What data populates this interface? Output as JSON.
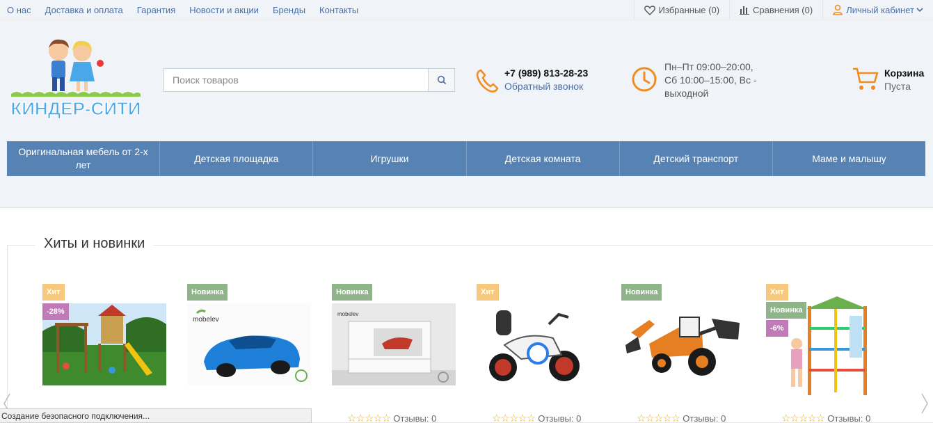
{
  "topnav": [
    "О нас",
    "Доставка и оплата",
    "Гарантия",
    "Новости и акции",
    "Бренды",
    "Контакты"
  ],
  "top_right": {
    "favorites": "Избранные (0)",
    "compare": "Сравнения (0)",
    "account": "Личный кабинет"
  },
  "logo_text": "КИНДЕР-СИТИ",
  "search": {
    "placeholder": "Поиск товаров"
  },
  "contacts": {
    "phone": "+7 (989) 813-28-23",
    "callback": "Обратный звонок"
  },
  "hours": "Пн–Пт 09:00–20:00, Сб 10:00–15:00, Вс - выходной",
  "cart": {
    "title": "Корзина",
    "status": "Пуста"
  },
  "main_nav": [
    "Оригинальная мебель от 2-х лет",
    "Детская площадка",
    "Игрушки",
    "Детская комната",
    "Детский транспорт",
    "Маме и малышу"
  ],
  "section_title": "Хиты и новинки",
  "badges": {
    "hit": "Хит",
    "new": "Новинка"
  },
  "products": [
    {
      "badges": [
        "Хит",
        "-28%"
      ],
      "image": "playground"
    },
    {
      "badges": [
        "Новинка"
      ],
      "image": "car-bed",
      "brand": "mobelev"
    },
    {
      "badges": [
        "Новинка"
      ],
      "image": "dresser",
      "brand": "mobelev"
    },
    {
      "badges": [
        "Хит"
      ],
      "image": "kids-motorbike"
    },
    {
      "badges": [
        "Новинка"
      ],
      "image": "kids-tractor"
    },
    {
      "badges": [
        "Хит",
        "Новинка",
        "-6%"
      ],
      "image": "sport-complex"
    }
  ],
  "reviews_label": "Отзывы: 0",
  "status_bar": "Создание безопасного подключения...",
  "colors": {
    "accent": "#f28c1e",
    "nav": "#5783b4",
    "link": "#4a6fa5"
  }
}
